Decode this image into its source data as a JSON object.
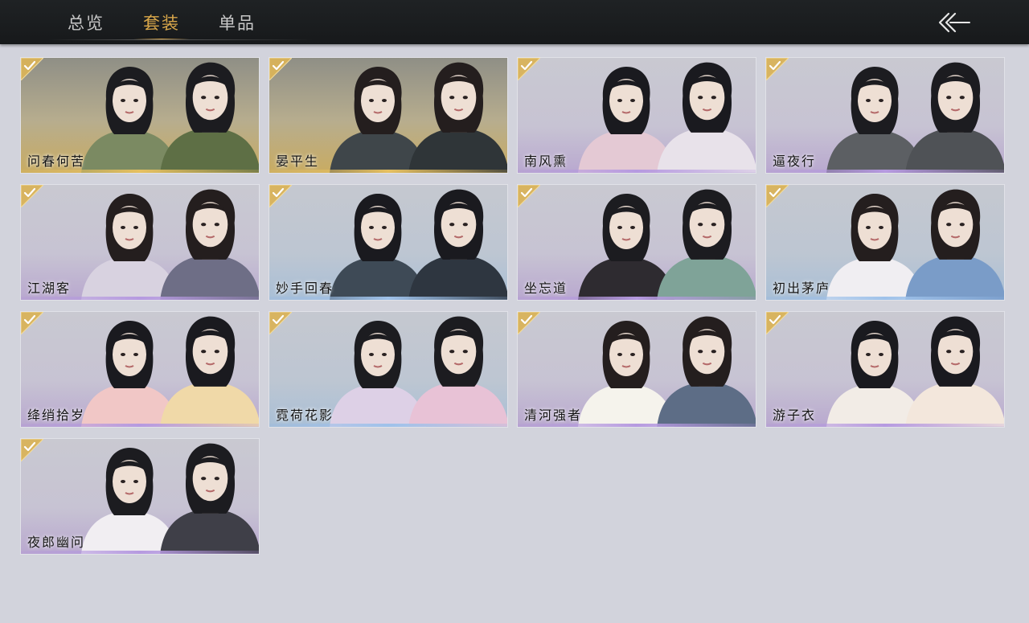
{
  "topbar": {
    "tabs": [
      {
        "label": "总览",
        "active": false
      },
      {
        "label": "套装",
        "active": true
      },
      {
        "label": "单品",
        "active": false
      }
    ],
    "back_icon": "back-arrow-icon"
  },
  "colors": {
    "topbar_bg": "#1b1d1f",
    "page_bg": "#d2d3dc",
    "active_tab": "#d9a74a",
    "inactive_tab": "#c8c8c8",
    "check_gold": "#d9b35a"
  },
  "outfits": [
    {
      "name": "问春何苦",
      "owned": true,
      "rarity": "gold"
    },
    {
      "name": "晏平生",
      "owned": true,
      "rarity": "gold"
    },
    {
      "name": "南风熏",
      "owned": true,
      "rarity": "purple"
    },
    {
      "name": "逼夜行",
      "owned": true,
      "rarity": "purple"
    },
    {
      "name": "江湖客",
      "owned": true,
      "rarity": "purple"
    },
    {
      "name": "妙手回春",
      "owned": true,
      "rarity": "blue"
    },
    {
      "name": "坐忘道",
      "owned": true,
      "rarity": "purple"
    },
    {
      "name": "初出茅庐",
      "owned": true,
      "rarity": "blue"
    },
    {
      "name": "绛绡拾岁",
      "owned": true,
      "rarity": "purple"
    },
    {
      "name": "霓荷花影",
      "owned": true,
      "rarity": "blue"
    },
    {
      "name": "清河强者",
      "owned": true,
      "rarity": "purple"
    },
    {
      "name": "游子衣",
      "owned": true,
      "rarity": "purple"
    },
    {
      "name": "夜郎幽问",
      "owned": true,
      "rarity": "purple"
    }
  ]
}
